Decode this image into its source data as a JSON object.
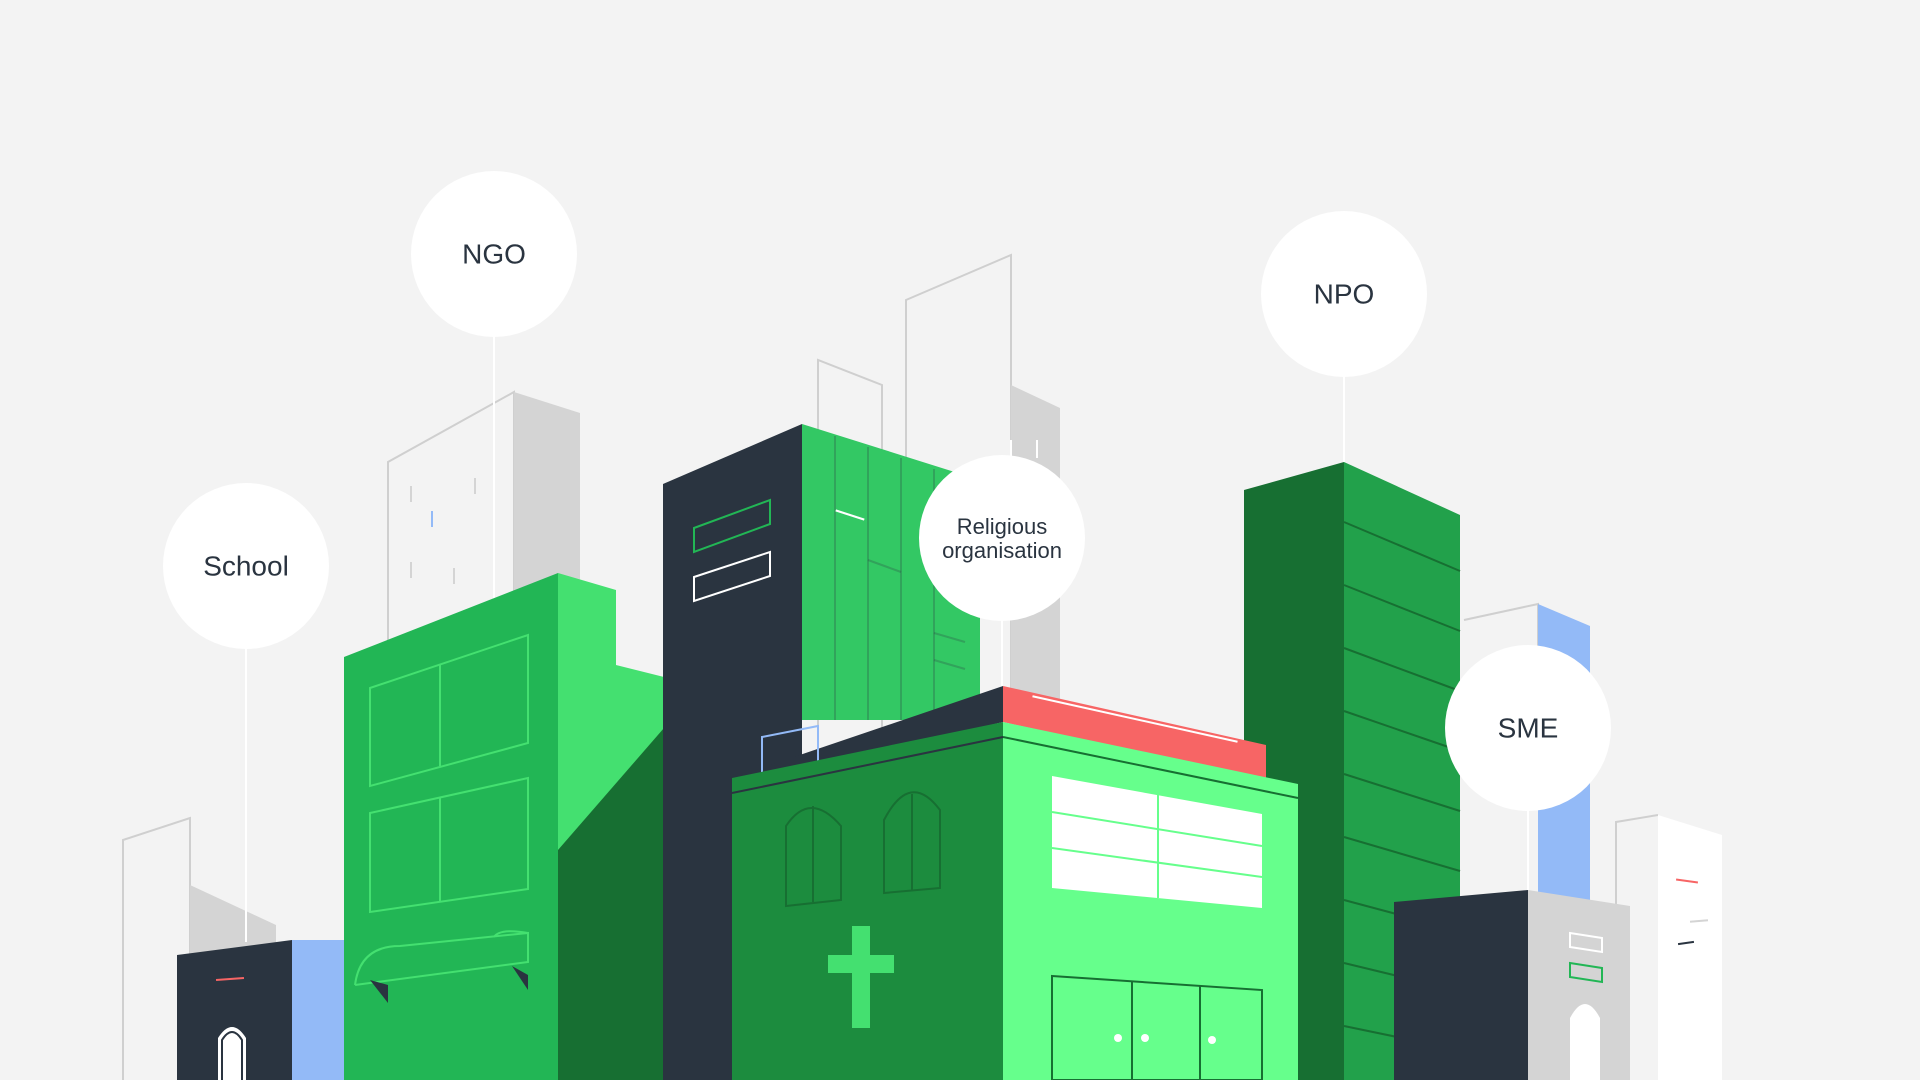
{
  "labels": {
    "school": "School",
    "ngo": "NGO",
    "religious_line1": "Religious",
    "religious_line2": "organisation",
    "npo": "NPO",
    "sme": "SME"
  },
  "colors": {
    "background": "#f3f3f3",
    "dark_slate": "#2a3440",
    "green_light": "#44e070",
    "green_mid": "#22b655",
    "green_dark": "#176f32",
    "green_bright": "#66ff8c",
    "coral": "#f76565",
    "blue": "#93baf7",
    "grey": "#d4d4d4",
    "white": "#ffffff"
  }
}
